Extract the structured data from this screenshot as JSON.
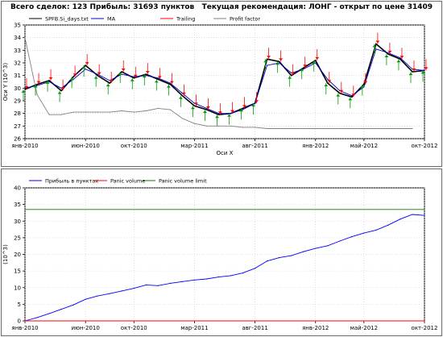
{
  "summary_title": "Всего сделок: 123 Прибыль: 31693 пунктов   Текущая рекомендация: ЛОНГ - открыт по цене 31409",
  "colors": {
    "price": "#000000",
    "ma": "#0000cc",
    "trailing": "#ff0000",
    "profit_factor": "#808080",
    "profit": "#0000ff",
    "panic_volume": "#ff0000",
    "panic_volume_limit": "#008000",
    "buy_marker": "#009900",
    "sell_marker": "#ff0000"
  },
  "chart_data": [
    {
      "type": "line",
      "ylabel": "Оси Y (10^3)",
      "xlabel": "Оси X",
      "x_ticks": [
        "янв-2010",
        "июн-2010",
        "окт-2010",
        "мар-2011",
        "авг-2011",
        "янв-2012",
        "май-2012",
        "окт-2012"
      ],
      "y_ticks": [
        26,
        27,
        28,
        29,
        30,
        31,
        32,
        33,
        34,
        35
      ],
      "ylim": [
        26,
        35
      ],
      "grid": true,
      "legend": [
        "SPFB.Si_days.txt",
        "MA",
        "Trailing",
        "Profit factor"
      ],
      "legend_placement": "top",
      "series": [
        {
          "name": "SPFB.Si_days.txt",
          "x": [
            "янв-2010",
            "фев-2010",
            "мар-2010",
            "апр-2010",
            "май-2010",
            "июн-2010",
            "июл-2010",
            "авг-2010",
            "сен-2010",
            "окт-2010",
            "ноя-2010",
            "дек-2010",
            "янв-2011",
            "фев-2011",
            "мар-2011",
            "апр-2011",
            "май-2011",
            "июн-2011",
            "июл-2011",
            "авг-2011",
            "сен-2011",
            "окт-2011",
            "ноя-2011",
            "дек-2011",
            "янв-2012",
            "фев-2012",
            "мар-2012",
            "апр-2012",
            "май-2012",
            "июн-2012",
            "июл-2012",
            "авг-2012",
            "сен-2012",
            "окт-2012"
          ],
          "values": [
            29.9,
            30.3,
            30.6,
            29.8,
            30.9,
            31.8,
            31.0,
            30.4,
            31.3,
            30.8,
            31.1,
            30.7,
            30.3,
            29.4,
            28.6,
            28.3,
            27.9,
            28.0,
            28.4,
            28.8,
            32.3,
            32.1,
            31.0,
            31.6,
            32.2,
            30.4,
            29.6,
            29.3,
            30.3,
            33.5,
            32.7,
            32.3,
            31.3,
            31.4
          ]
        },
        {
          "name": "MA",
          "x": [
            "янв-2010",
            "фев-2010",
            "мар-2010",
            "апр-2010",
            "май-2010",
            "июн-2010",
            "июл-2010",
            "авг-2010",
            "сен-2010",
            "окт-2010",
            "ноя-2010",
            "дек-2010",
            "янв-2011",
            "фев-2011",
            "мар-2011",
            "апр-2011",
            "май-2011",
            "июн-2011",
            "июл-2011",
            "авг-2011",
            "сен-2011",
            "окт-2011",
            "ноя-2011",
            "дек-2011",
            "янв-2012",
            "фев-2012",
            "мар-2012",
            "апр-2012",
            "май-2012",
            "июн-2012",
            "июл-2012",
            "авг-2012",
            "сен-2012",
            "окт-2012"
          ],
          "values": [
            30.0,
            30.2,
            30.5,
            30.0,
            30.7,
            31.5,
            31.1,
            30.6,
            31.1,
            30.9,
            31.0,
            30.8,
            30.4,
            29.6,
            28.8,
            28.4,
            28.0,
            28.0,
            28.3,
            28.8,
            31.8,
            32.0,
            31.2,
            31.5,
            32.0,
            30.7,
            29.8,
            29.4,
            30.1,
            33.1,
            32.8,
            32.4,
            31.5,
            31.4
          ]
        },
        {
          "name": "Profit factor",
          "x": [
            "янв-2010",
            "фев-2010",
            "мар-2010",
            "апр-2010",
            "май-2010",
            "июн-2010",
            "июл-2010",
            "авг-2010",
            "сен-2010",
            "окт-2010",
            "ноя-2010",
            "дек-2010",
            "янв-2011",
            "фев-2011",
            "мар-2011",
            "апр-2011",
            "май-2011",
            "июн-2011",
            "июл-2011",
            "авг-2011",
            "сен-2011",
            "окт-2011",
            "ноя-2011",
            "дек-2011",
            "янв-2012",
            "фев-2012",
            "мар-2012",
            "апр-2012",
            "май-2012",
            "июн-2012",
            "июл-2012",
            "авг-2012",
            "сен-2012"
          ],
          "values": [
            34.0,
            29.5,
            27.9,
            27.9,
            28.1,
            28.1,
            28.1,
            28.1,
            28.2,
            28.1,
            28.2,
            28.4,
            28.3,
            27.6,
            27.2,
            27.0,
            27.0,
            27.0,
            26.9,
            26.9,
            26.8,
            26.8,
            26.8,
            26.8,
            26.8,
            26.8,
            26.8,
            26.8,
            26.8,
            26.8,
            26.8,
            26.8,
            26.8
          ]
        }
      ]
    },
    {
      "type": "line",
      "ylabel": "(10^3)",
      "x_ticks": [
        "янв-2010",
        "июн-2010",
        "окт-2010",
        "мар-2011",
        "авг-2011",
        "янв-2012",
        "май-2012",
        "окт-2012"
      ],
      "y_ticks": [
        0,
        5,
        10,
        15,
        20,
        25,
        30,
        35,
        40
      ],
      "ylim": [
        0,
        40
      ],
      "grid": true,
      "legend": [
        "Прибыль в пунктах",
        "Panic volume",
        "Panic volume limit"
      ],
      "legend_placement": "top",
      "series": [
        {
          "name": "Прибыль в пунктах",
          "x": [
            "янв-2010",
            "фев-2010",
            "мар-2010",
            "апр-2010",
            "май-2010",
            "июн-2010",
            "июл-2010",
            "авг-2010",
            "сен-2010",
            "окт-2010",
            "ноя-2010",
            "дек-2010",
            "янв-2011",
            "фев-2011",
            "мар-2011",
            "апр-2011",
            "май-2011",
            "июн-2011",
            "июл-2011",
            "авг-2011",
            "сен-2011",
            "окт-2011",
            "ноя-2011",
            "дек-2011",
            "янв-2012",
            "фев-2012",
            "мар-2012",
            "апр-2012",
            "май-2012",
            "июн-2012",
            "июл-2012",
            "авг-2012",
            "сен-2012",
            "окт-2012"
          ],
          "values": [
            0.0,
            1.0,
            2.2,
            3.5,
            4.8,
            6.5,
            7.5,
            8.2,
            9.0,
            9.8,
            10.8,
            10.6,
            11.3,
            11.8,
            12.3,
            12.6,
            13.2,
            13.6,
            14.4,
            15.8,
            18.0,
            19.0,
            19.6,
            20.8,
            21.8,
            22.6,
            24.0,
            25.3,
            26.4,
            27.3,
            28.8,
            30.6,
            32.0,
            31.7
          ]
        },
        {
          "name": "Panic volume",
          "x": [
            "янв-2010",
            "окт-2012"
          ],
          "values": [
            0,
            0
          ]
        },
        {
          "name": "Panic volume limit",
          "x": [
            "янв-2010",
            "окт-2012"
          ],
          "values": [
            33.5,
            33.5
          ]
        }
      ]
    }
  ]
}
